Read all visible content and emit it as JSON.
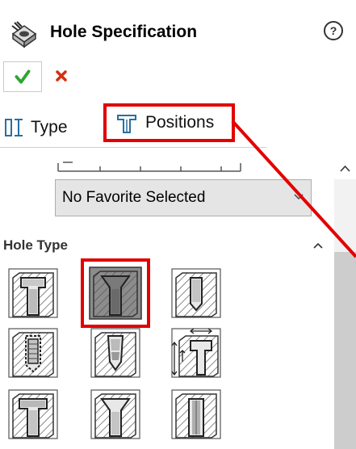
{
  "property_manager": {
    "title": "Hole Specification",
    "icon": "hole-wizard-icon",
    "help_icon": "help-question-icon"
  },
  "actions": {
    "ok_icon": "checkmark-icon",
    "cancel_icon": "close-x-icon"
  },
  "tabs": [
    {
      "label": "Type",
      "icon": "hole-type-tab-icon",
      "active": true
    },
    {
      "label": "Positions",
      "icon": "hole-positions-tab-icon",
      "active": false,
      "highlighted": true
    }
  ],
  "favorite": {
    "selected_value": "No Favorite Selected",
    "icon": "dropdown-arrow-icon"
  },
  "hole_type_section": {
    "title": "Hole Type",
    "toggle_icon": "collapse-chevron-icon",
    "buttons": [
      {
        "name": "counterbore-icon",
        "selected": false
      },
      {
        "name": "countersink-icon",
        "selected": true
      },
      {
        "name": "hole-icon",
        "selected": false
      },
      {
        "name": "straight-tap-icon",
        "selected": false
      },
      {
        "name": "tapered-tap-icon",
        "selected": false
      },
      {
        "name": "legacy-hole-icon",
        "selected": false
      },
      {
        "name": "counterbore-slot-icon",
        "selected": false
      },
      {
        "name": "countersink-slot-icon",
        "selected": false
      },
      {
        "name": "slot-icon",
        "selected": false
      }
    ]
  },
  "colors": {
    "highlight": "#e20000",
    "ok_green": "#2fa52f",
    "cancel_red": "#d32f0f",
    "select_bg": "#e5e5e5",
    "selected_button_bg": "#8c8c8c"
  }
}
